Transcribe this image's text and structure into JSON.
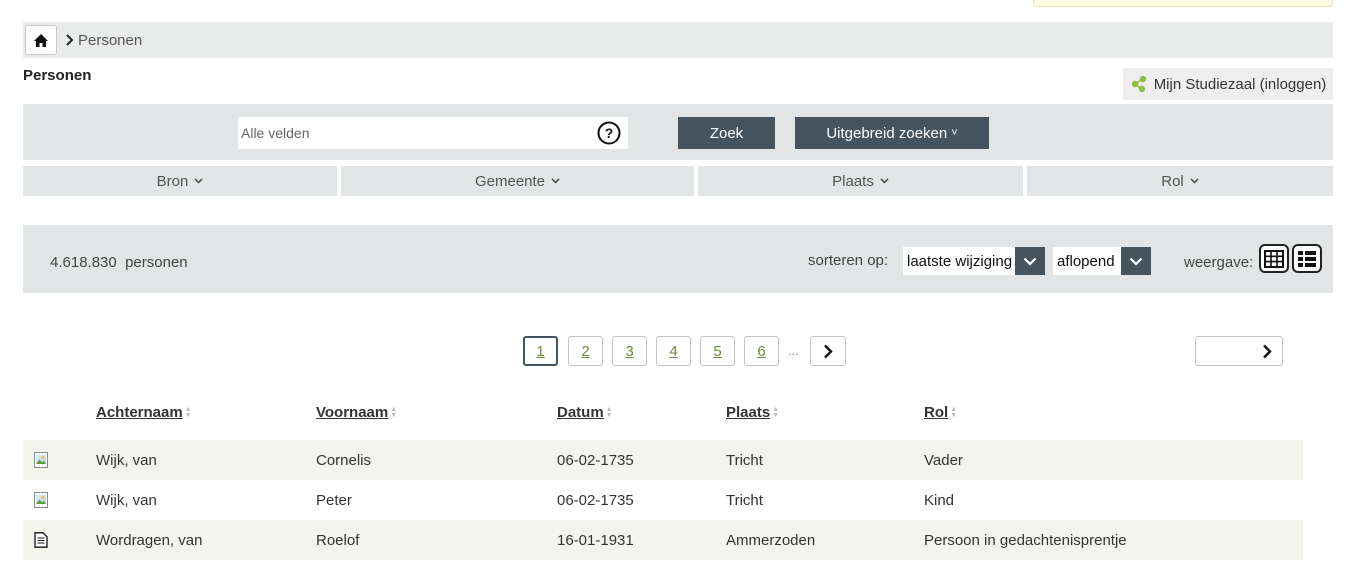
{
  "breadcrumb": {
    "home_icon": "home-icon",
    "current": "Personen"
  },
  "page": {
    "title": "Personen"
  },
  "studiezaal": {
    "label": "Mijn Studiezaal (inloggen)",
    "icon": "share-icon"
  },
  "search": {
    "placeholder": "Alle velden",
    "submit_label": "Zoek",
    "advanced_label": "Uitgebreid zoeken",
    "advanced_caret": "˅"
  },
  "facets": [
    {
      "label": "Bron"
    },
    {
      "label": "Gemeente"
    },
    {
      "label": "Plaats"
    },
    {
      "label": "Rol"
    }
  ],
  "results": {
    "count": "4.618.830",
    "unit": "personen",
    "sort_label": "sorteren op:",
    "sort_field": "laatste wijziging",
    "sort_order": "aflopend",
    "view_label": "weergave:"
  },
  "pagination": {
    "pages": [
      "1",
      "2",
      "3",
      "4",
      "5",
      "6"
    ],
    "current": "1",
    "ellipsis": "..."
  },
  "table": {
    "columns": [
      "Achternaam",
      "Voornaam",
      "Datum",
      "Plaats",
      "Rol"
    ],
    "rows": [
      {
        "icon": "image-icon",
        "achternaam": "Wijk, van",
        "voornaam": "Cornelis",
        "datum": "06-02-1735",
        "plaats": "Tricht",
        "rol": "Vader"
      },
      {
        "icon": "image-icon",
        "achternaam": "Wijk, van",
        "voornaam": "Peter",
        "datum": "06-02-1735",
        "plaats": "Tricht",
        "rol": "Kind"
      },
      {
        "icon": "document-icon",
        "achternaam": "Wordragen, van",
        "voornaam": "Roelof",
        "datum": "16-01-1931",
        "plaats": "Ammerzoden",
        "rol": "Persoon in gedachtenisprentje"
      }
    ]
  },
  "colors": {
    "dark_button": "#46545f",
    "panel": "#e2e5e5",
    "link_green": "#6f8a3a",
    "row_alt": "#f3f4ee"
  }
}
